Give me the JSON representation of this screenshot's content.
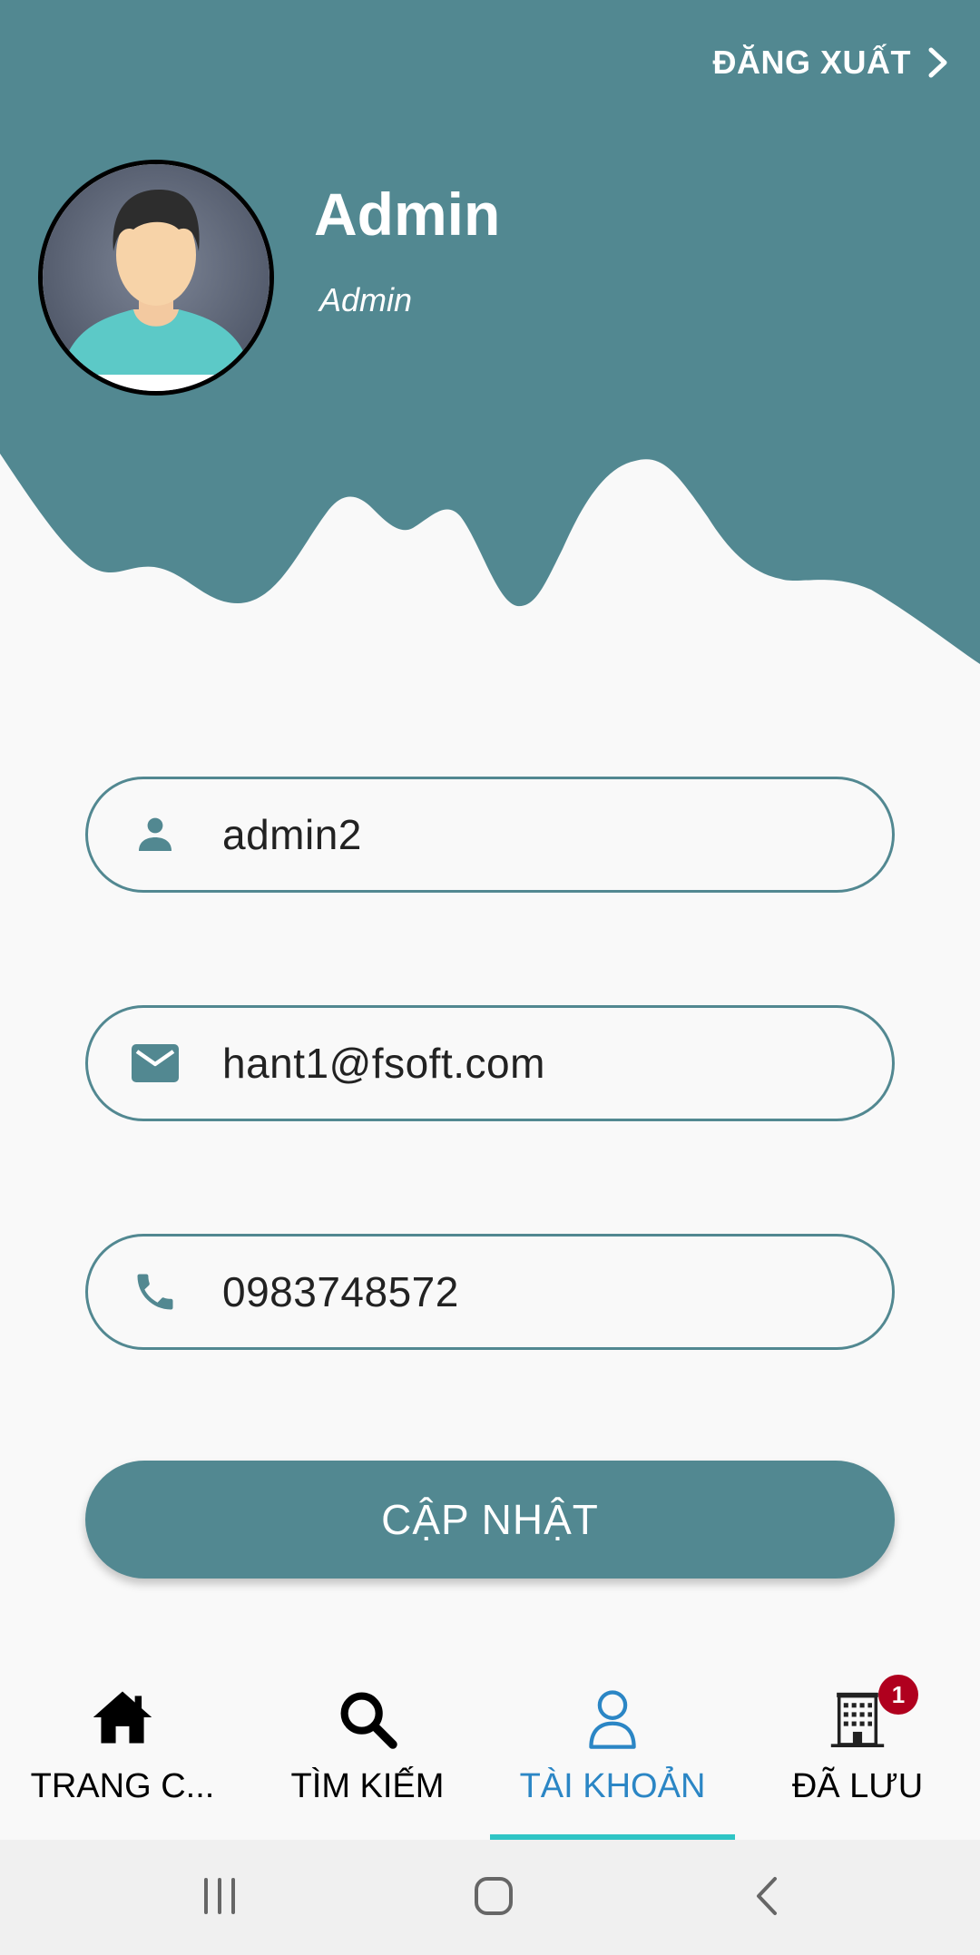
{
  "header": {
    "logout_label": "ĐĂNG XUẤT",
    "user_name": "Admin",
    "user_role": "Admin",
    "background_color": "#528891"
  },
  "form": {
    "username": {
      "value": "admin2",
      "icon": "person-icon"
    },
    "email": {
      "value": "hant1@fsoft.com",
      "icon": "mail-icon"
    },
    "phone": {
      "value": "0983748572",
      "icon": "phone-icon"
    },
    "update_label": "CẬP NHẬT"
  },
  "bottom_nav": {
    "items": [
      {
        "label": "TRANG C...",
        "icon": "home-icon",
        "active": false
      },
      {
        "label": "TÌM KIẾM",
        "icon": "search-icon",
        "active": false
      },
      {
        "label": "TÀI KHOẢN",
        "icon": "account-icon",
        "active": true
      },
      {
        "label": "ĐÃ LƯU",
        "icon": "building-icon",
        "active": false,
        "badge": "1"
      }
    ],
    "active_color": "#2b86c5",
    "indicator_color": "#2fc5c5",
    "badge_color": "#b0001e"
  },
  "system_nav": {
    "icons": [
      "recent-apps-icon",
      "home-circle-icon",
      "back-icon"
    ]
  }
}
